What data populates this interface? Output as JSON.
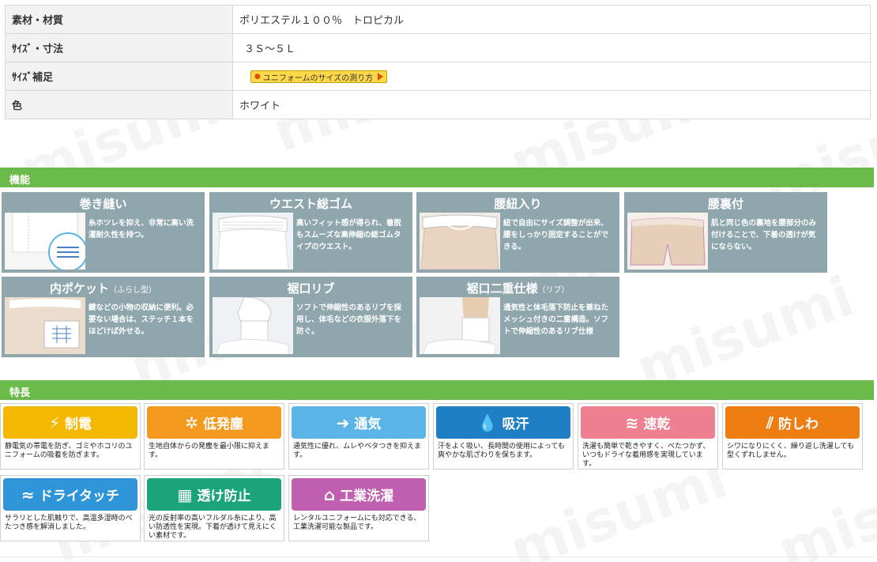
{
  "spec": [
    {
      "key": "素材・材質",
      "value": "ポリエステル１００％　トロピカル"
    },
    {
      "key": "ｻｲｽﾞ・寸法",
      "value": "３Ｓ～５Ｌ"
    },
    {
      "key": "ｻｲｽﾞ補足",
      "link": "ユニフォームのサイズの測り方"
    },
    {
      "key": "色",
      "value": "ホワイト"
    }
  ],
  "watermark": "misumi",
  "sections": {
    "function": "機能",
    "features": "特長"
  },
  "functions": [
    {
      "title": "巻き縫い",
      "desc": "糸ホツレを抑え、非常に高い洗濯耐久性を持つ。",
      "icon": "stitch-image"
    },
    {
      "title": "ウエスト総ゴム",
      "desc": "高いフィット感が得られ、着脱もスムーズな高伸縮の総ゴムタイプのウエスト。",
      "icon": "waist-image"
    },
    {
      "title": "腰紐入り",
      "desc": "紐で自由にサイズ調整が出来、腰をしっかり固定することができる。",
      "icon": "string-image"
    },
    {
      "title": "腰裏付",
      "desc": "肌と同じ色の裏地を腰部分のみ付けることで、下着の透けが気にならない。",
      "icon": "lining-image"
    },
    {
      "title": "内ポケット",
      "title_note": "（ふらし型）",
      "desc": "鍵などの小物の収納に便利。必要ない場合は、ステッチ１本をほどけば外せる。",
      "icon": "pocket-image"
    },
    {
      "title": "裾口リブ",
      "desc": "ソフトで伸縮性のあるリブを採用し、体毛などの衣服外落下を防ぐ。",
      "icon": "rib-image"
    },
    {
      "title": "裾口二重仕様",
      "title_note": "（リブ）",
      "desc": "通気性と体毛落下防止を兼ねたメッシュ付きの二重構造。ソフトで伸縮性のあるリブ仕様",
      "icon": "double-rib-image"
    }
  ],
  "features": [
    {
      "label": "制電",
      "color": "#f5b800",
      "icon": "lightning-icon",
      "glyph": "⚡",
      "desc": "静電気の帯電を防ぎ、ゴミやホコリのユニフォームの吸着を防ぎます。"
    },
    {
      "label": "低発塵",
      "color": "#f39a1e",
      "icon": "dust-icon",
      "glyph": "✲",
      "desc": "生地自体からの発塵を最小限に抑えます。"
    },
    {
      "label": "通気",
      "color": "#5ab4e5",
      "icon": "air-icon",
      "glyph": "➜",
      "desc": "通気性に優れ、ムレやベタつきを抑えます。"
    },
    {
      "label": "吸汗",
      "color": "#1f7fc4",
      "icon": "drop-icon",
      "glyph": "💧",
      "desc": "汗をよく吸い、長時間の使用によっても爽やかな肌ざわりを保ちます。"
    },
    {
      "label": "速乾",
      "color": "#ee8090",
      "icon": "quick-dry-icon",
      "glyph": "≋",
      "desc": "洗濯も簡単で乾きやすく、べたつかず、いつもドライな着用感を実現しています。"
    },
    {
      "label": "防しわ",
      "color": "#ee7d12",
      "icon": "wrinkle-icon",
      "glyph": "⫽",
      "desc": "シワになりにくく、繰り返し洗濯しても型くずれしません。"
    },
    {
      "label": "ドライタッチ",
      "color": "#2d95d8",
      "icon": "dry-touch-icon",
      "glyph": "≈",
      "desc": "サラリとした肌触りで、高温多湿時のべたつき感を解消しました。"
    },
    {
      "label": "透け防止",
      "color": "#1ba37a",
      "icon": "see-through-icon",
      "glyph": "▦",
      "desc": "光の反射率の高いフルダル糸により、高い防透性を実現。下着が透けて見えにくい素材です。"
    },
    {
      "label": "工業洗濯",
      "color": "#c05fb0",
      "icon": "hanger-icon",
      "glyph": "⌂",
      "desc": "レンタルユニフォームにも対応できる、工業洗濯可能な製品です。"
    }
  ]
}
